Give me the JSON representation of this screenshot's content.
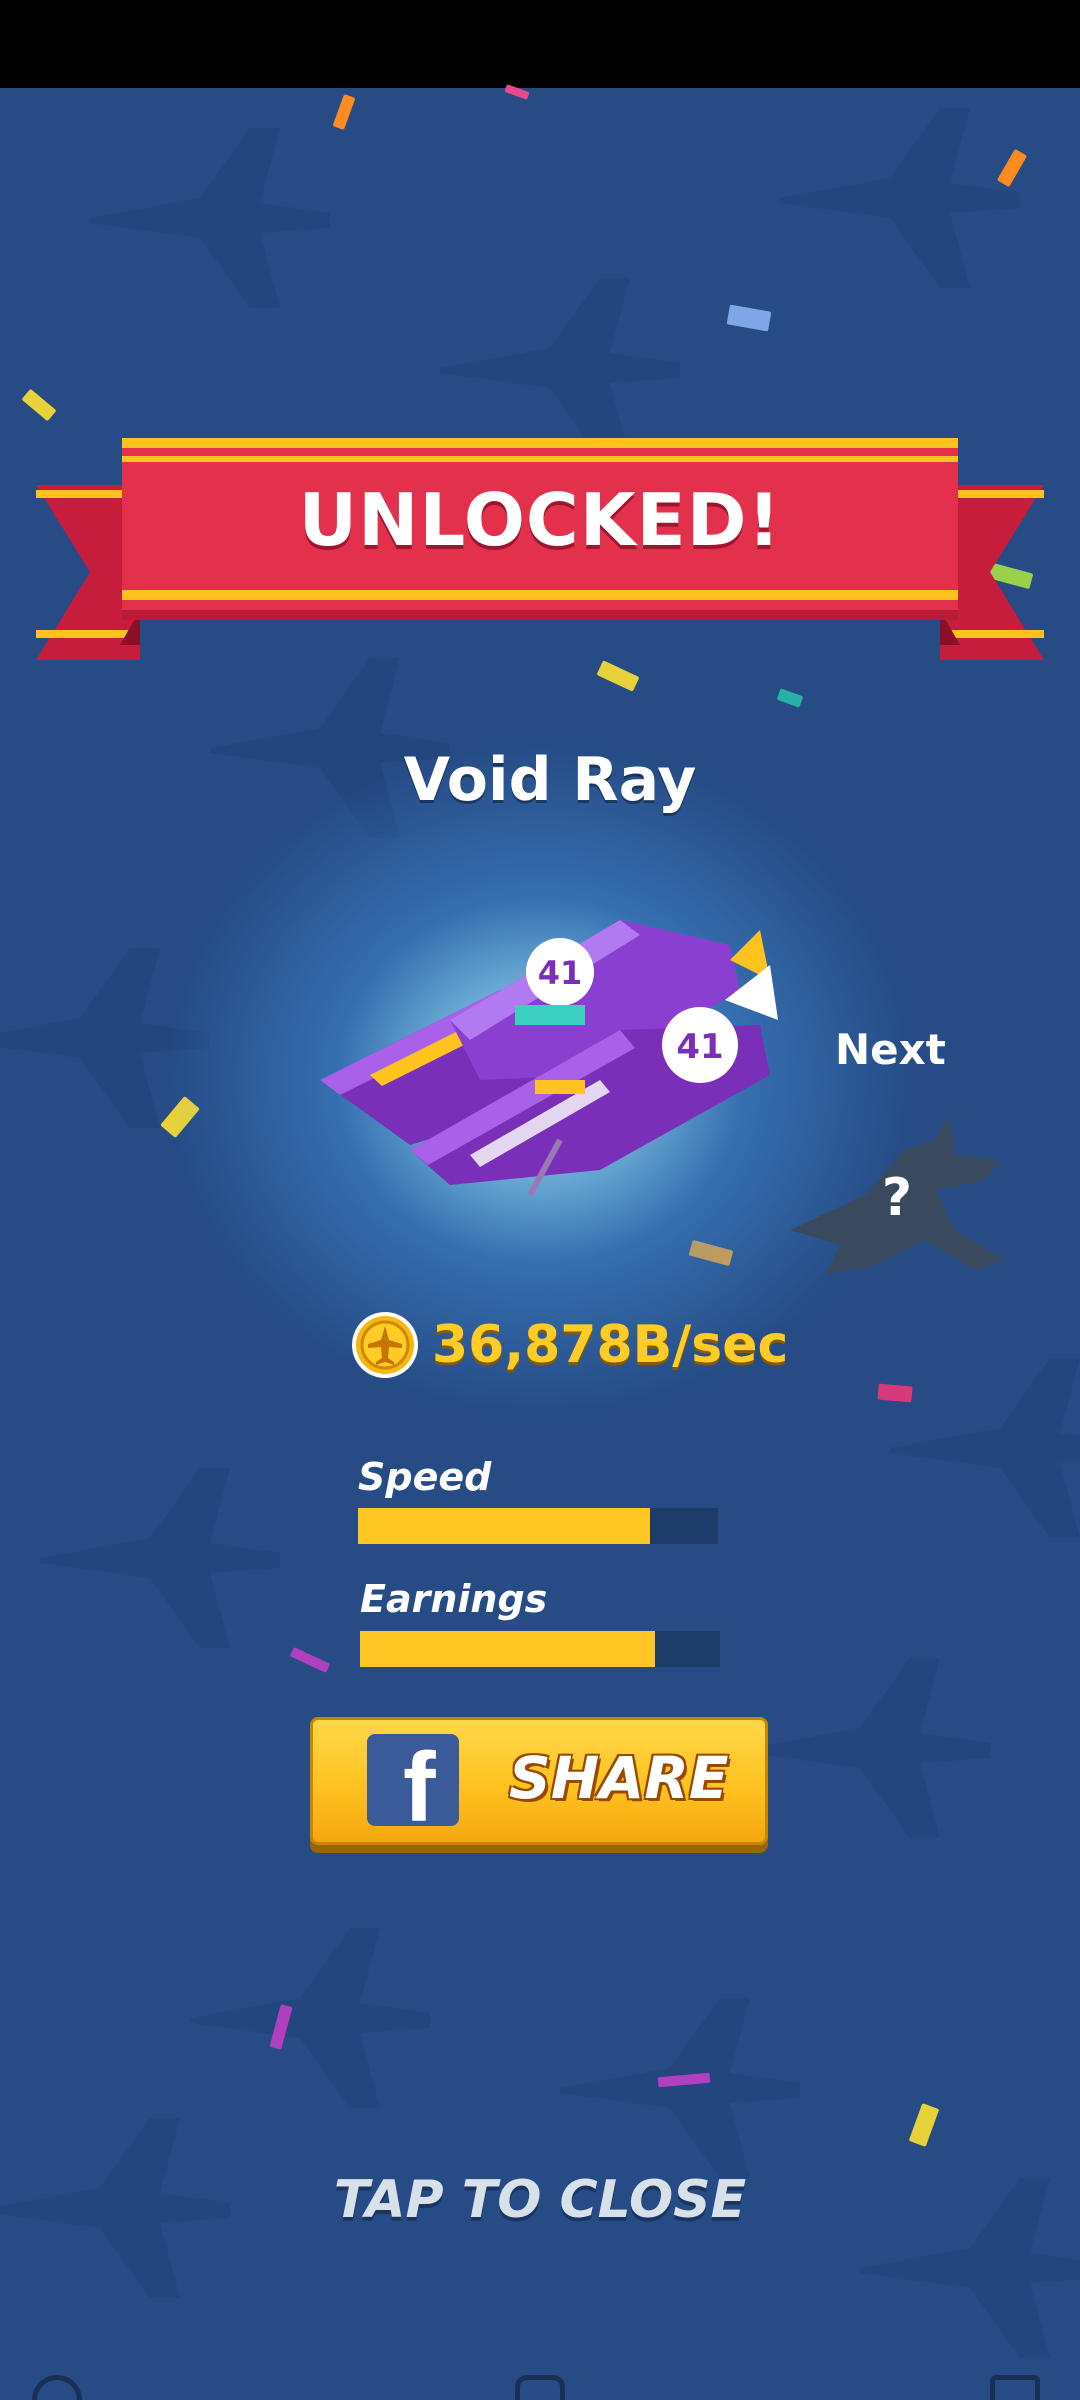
{
  "banner": {
    "title": "UNLOCKED!"
  },
  "plane": {
    "name": "Void Ray",
    "earnings_rate": "36,878B/sec",
    "ship_badge": "41"
  },
  "next": {
    "label": "Next",
    "mystery_symbol": "?"
  },
  "stats": [
    {
      "label": "Speed",
      "level": 0.81
    },
    {
      "label": "Earnings",
      "level": 0.82
    }
  ],
  "share": {
    "label": "SHARE",
    "icon": "facebook-icon"
  },
  "close": {
    "label": "TAP TO CLOSE"
  },
  "colors": {
    "background": "#264b85",
    "ribbon_red": "#e3314d",
    "ribbon_gold": "#ffc21f",
    "coin_gold": "#ffcc26",
    "stat_fill": "#ffc724",
    "ship_purple": "#8a3fd1"
  }
}
